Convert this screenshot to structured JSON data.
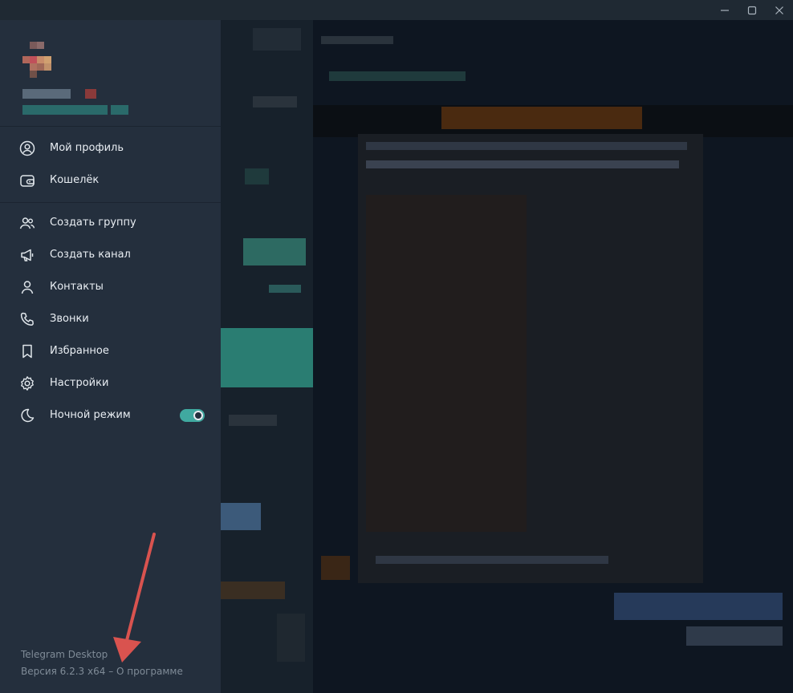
{
  "window": {
    "controls": [
      {
        "name": "minimize",
        "icon": "minimize-icon"
      },
      {
        "name": "maximize",
        "icon": "maximize-icon"
      },
      {
        "name": "close",
        "icon": "close-icon"
      }
    ]
  },
  "drawer": {
    "menu": [
      {
        "label": "Мой профиль",
        "icon": "profile-icon"
      },
      {
        "label": "Кошелёк",
        "icon": "wallet-icon"
      },
      {
        "label": "Создать группу",
        "icon": "group-icon"
      },
      {
        "label": "Создать канал",
        "icon": "megaphone-icon"
      },
      {
        "label": "Контакты",
        "icon": "contact-icon"
      },
      {
        "label": "Звонки",
        "icon": "phone-icon"
      },
      {
        "label": "Избранное",
        "icon": "bookmark-icon"
      },
      {
        "label": "Настройки",
        "icon": "gear-icon"
      },
      {
        "label": "Ночной режим",
        "icon": "moon-icon",
        "toggle": true
      }
    ],
    "night_mode_on": true,
    "footer": {
      "app_name": "Telegram Desktop",
      "version": "Версия 6.2.3 x64",
      "separator": " – ",
      "about_link": "О программе"
    }
  },
  "colors": {
    "drawer_bg": "#242f3d",
    "accent_toggle": "#40a9a0",
    "annotation_arrow": "#d9534f"
  }
}
